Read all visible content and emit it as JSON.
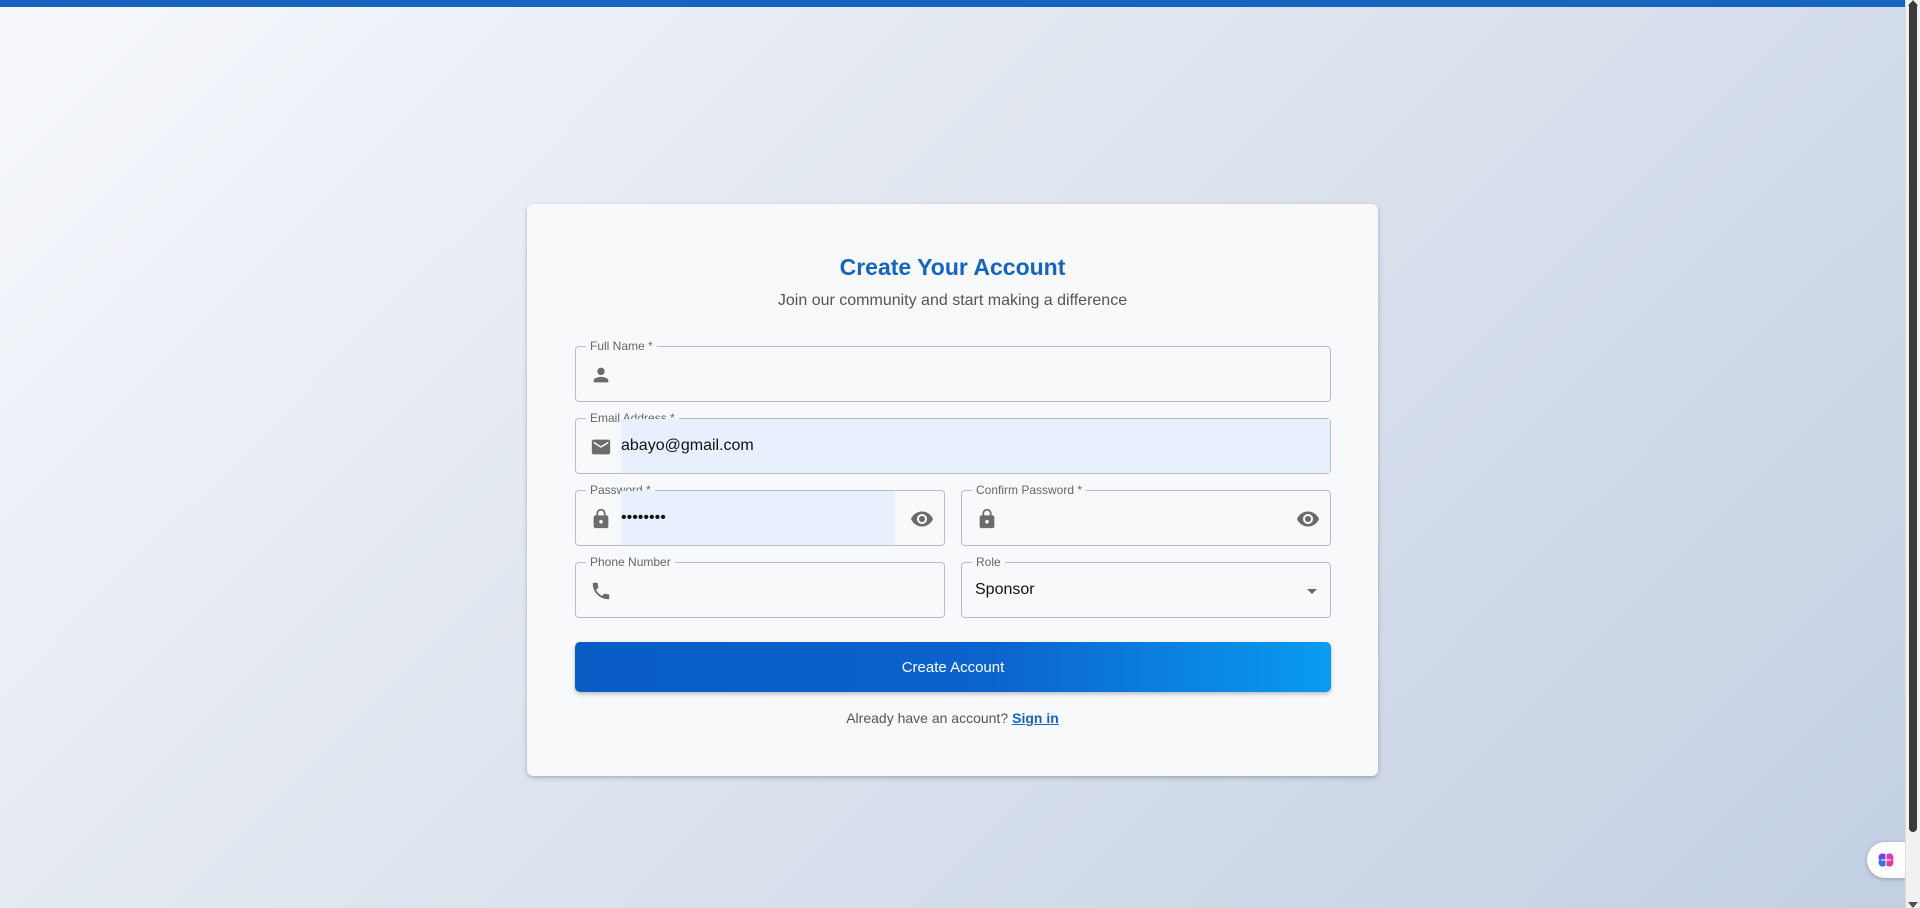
{
  "header": {
    "accent_color": "#1565c0"
  },
  "form": {
    "title": "Create Your Account",
    "subtitle": "Join our community and start making a difference",
    "full_name": {
      "label": "Full Name *",
      "value": "",
      "icon": "person-icon"
    },
    "email": {
      "label": "Email Address *",
      "value": "abayo@gmail.com",
      "icon": "mail-icon"
    },
    "password": {
      "label": "Password *",
      "value": "xxxxxxxx",
      "icon": "lock-icon",
      "toggle_icon": "eye-icon"
    },
    "confirm_password": {
      "label": "Confirm Password *",
      "value": "",
      "icon": "lock-icon",
      "toggle_icon": "eye-icon"
    },
    "phone": {
      "label": "Phone Number",
      "value": "",
      "icon": "phone-icon"
    },
    "role": {
      "label": "Role",
      "value": "Sponsor",
      "icon": "chevron-down-icon"
    },
    "submit_label": "Create Account",
    "footer_text": "Already have an account?",
    "signin_label": "Sign in"
  },
  "widget": {
    "icon": "brain-icon"
  }
}
